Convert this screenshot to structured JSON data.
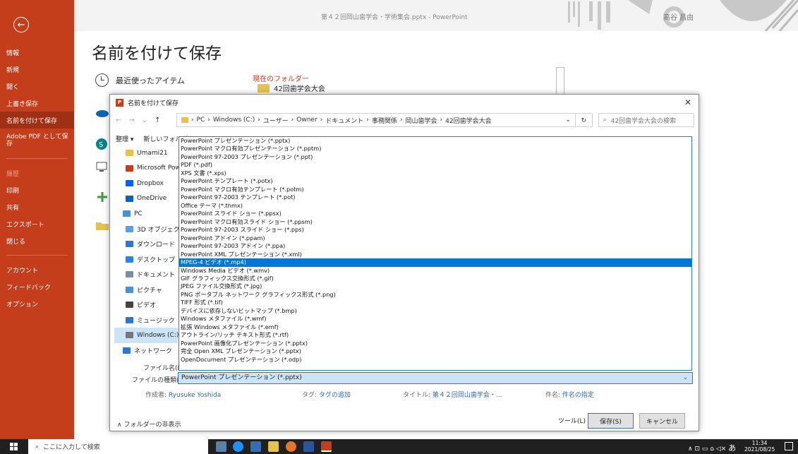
{
  "window": {
    "title": "第４２回岡山歯学会・学術集会.pptx - PowerPoint",
    "user": "高谷 昌由"
  },
  "sidebar": {
    "items": [
      {
        "label": "情報"
      },
      {
        "label": "新規"
      },
      {
        "label": "開く"
      },
      {
        "label": "上書き保存"
      },
      {
        "label": "名前を付けて保存",
        "active": true
      },
      {
        "label": "Adobe PDF として保存"
      },
      {
        "label": "履歴",
        "disabled": true
      },
      {
        "label": "印刷"
      },
      {
        "label": "共有"
      },
      {
        "label": "エクスポート"
      },
      {
        "label": "閉じる"
      },
      {
        "label": "アカウント"
      },
      {
        "label": "フィードバック"
      },
      {
        "label": "オプション"
      }
    ]
  },
  "page": {
    "title": "名前を付けて保存",
    "recent": "最近使ったアイテム",
    "current_folder_label": "現在のフォルダー",
    "current_folder": "42回歯学会大会"
  },
  "dialog": {
    "title": "名前を付けて保存",
    "address": {
      "segments": [
        "PC",
        "Windows (C:)",
        "ユーザー",
        "Owner",
        "ドキュメント",
        "事務関係",
        "岡山歯学会",
        "42回歯学会大会"
      ]
    },
    "search_placeholder": "42回歯学会大会の検索",
    "toolbar": {
      "organize": "整理 ▾",
      "new_folder": "新しいフォルダー"
    },
    "tree": [
      "Umami21",
      "Microsoft PowerPoint",
      "Dropbox",
      "OneDrive",
      "PC",
      "3D オブジェクト",
      "ダウンロード",
      "デスクトップ",
      "ドキュメント",
      "ピクチャ",
      "ビデオ",
      "ミュージック",
      "Windows (C:)",
      "ネットワーク"
    ],
    "filename_label": "ファイル名(N):",
    "filetype_label": "ファイルの種類(T):",
    "filetype_value": "PowerPoint プレゼンテーション (*.pptx)",
    "filetypes": [
      "PowerPoint プレゼンテーション (*.pptx)",
      "PowerPoint マクロ有効プレゼンテーション (*.pptm)",
      "PowerPoint 97-2003 プレゼンテーション (*.ppt)",
      "PDF (*.pdf)",
      "XPS 文書 (*.xps)",
      "PowerPoint テンプレート (*.potx)",
      "PowerPoint マクロ有効テンプレート (*.potm)",
      "PowerPoint 97-2003 テンプレート (*.pot)",
      "Office テーマ (*.thmx)",
      "PowerPoint スライド ショー (*.ppsx)",
      "PowerPoint マクロ有効スライド ショー (*.ppsm)",
      "PowerPoint 97-2003 スライド ショー (*.pps)",
      "PowerPoint アドイン (*.ppam)",
      "PowerPoint 97-2003 アドイン (*.ppa)",
      "PowerPoint XML プレゼンテーション (*.xml)",
      "MPEG-4 ビデオ (*.mp4)",
      "Windows Media ビデオ (*.wmv)",
      "GIF グラフィックス交換形式 (*.gif)",
      "JPEG ファイル交換形式 (*.jpg)",
      "PNG ポータブル ネットワーク グラフィックス形式 (*.png)",
      "TIFF 形式 (*.tif)",
      "デバイスに依存しないビットマップ (*.bmp)",
      "Windows メタファイル (*.wmf)",
      "拡張 Windows メタファイル (*.emf)",
      "アウトライン/リッチ テキスト形式 (*.rtf)",
      "PowerPoint 画像化プレゼンテーション (*.pptx)",
      "完全 Open XML プレゼンテーション (*.pptx)",
      "OpenDocument プレゼンテーション (*.odp)"
    ],
    "highlighted_index": 15,
    "meta": {
      "author_label": "作成者:",
      "author": "Ryusuke Yoshida",
      "tag_label": "タグ:",
      "tag": "タグの追加",
      "title_label": "タイトル:",
      "title": "第４２回岡山歯学会・...",
      "subject_label": "件名:",
      "subject": "件名の指定"
    },
    "hide_folders": "∧ フォルダーの非表示",
    "tools": "ツール(L) ▾",
    "save": "保存(S)",
    "cancel": "キャンセル"
  },
  "taskbar": {
    "search": "ここに入力して検索",
    "time": "11:34",
    "date": "2021/08/25",
    "ime": "あ"
  },
  "colors": {
    "accent": "#c43e1c",
    "highlight": "#0078d7"
  }
}
